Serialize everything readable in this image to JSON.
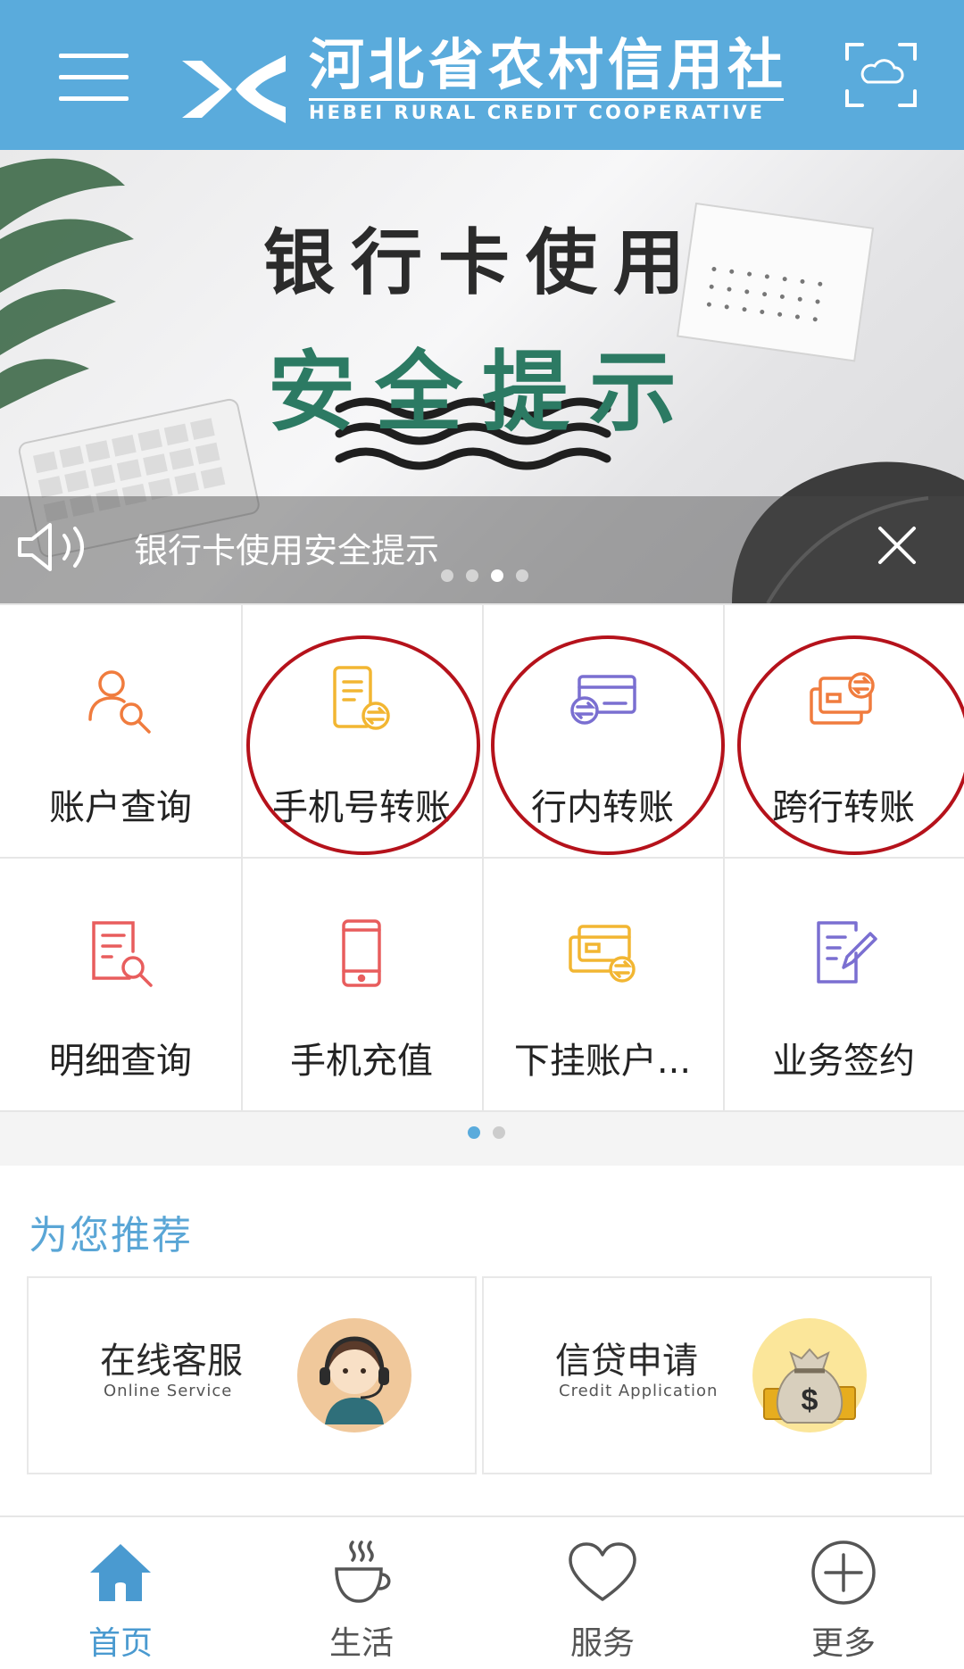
{
  "header": {
    "brand_cn": "河北省农村信用社",
    "brand_en": "HEBEI RURAL CREDIT COOPERATIVE",
    "menu_icon": "hamburger-menu-icon",
    "scan_icon": "scan-icon"
  },
  "banner": {
    "title_line1": "银行卡使用",
    "title_line2": "安全提示",
    "notice": "银行卡使用安全提示",
    "dots_total": 4,
    "dots_active": 3
  },
  "functions": [
    {
      "label": "账户查询",
      "icon": "account-query-icon",
      "color": "#f07c3e",
      "circled": false
    },
    {
      "label": "手机号转账",
      "icon": "phone-transfer-icon",
      "color": "#f2b632",
      "circled": true
    },
    {
      "label": "行内转账",
      "icon": "intra-bank-transfer-icon",
      "color": "#7a6fd1",
      "circled": true
    },
    {
      "label": "跨行转账",
      "icon": "inter-bank-transfer-icon",
      "color": "#f07c3e",
      "circled": true
    },
    {
      "label": "明细查询",
      "icon": "detail-query-icon",
      "color": "#e85d5d",
      "circled": false
    },
    {
      "label": "手机充值",
      "icon": "mobile-recharge-icon",
      "color": "#e85d5d",
      "circled": false
    },
    {
      "label": "下挂账户...",
      "icon": "linked-account-icon",
      "color": "#f2b632",
      "circled": false
    },
    {
      "label": "业务签约",
      "icon": "business-signing-icon",
      "color": "#7a6fd1",
      "circled": false
    }
  ],
  "grid_pages": {
    "total": 2,
    "active": 1
  },
  "recommend": {
    "title": "为您推荐",
    "cards": [
      {
        "cn": "在线客服",
        "en": "Online Service",
        "icon": "customer-service-icon"
      },
      {
        "cn": "信贷申请",
        "en": "Credit Application",
        "icon": "money-bag-icon"
      }
    ]
  },
  "tabbar": [
    {
      "label": "首页",
      "icon": "home-icon",
      "active": true
    },
    {
      "label": "生活",
      "icon": "coffee-cup-icon",
      "active": false
    },
    {
      "label": "服务",
      "icon": "heart-icon",
      "active": false
    },
    {
      "label": "更多",
      "icon": "plus-circle-icon",
      "active": false
    }
  ],
  "colors": {
    "header_bg": "#5aabdc",
    "accent": "#4a9ad0",
    "highlight_ring": "#b5121b",
    "banner_green": "#2c7a63"
  }
}
